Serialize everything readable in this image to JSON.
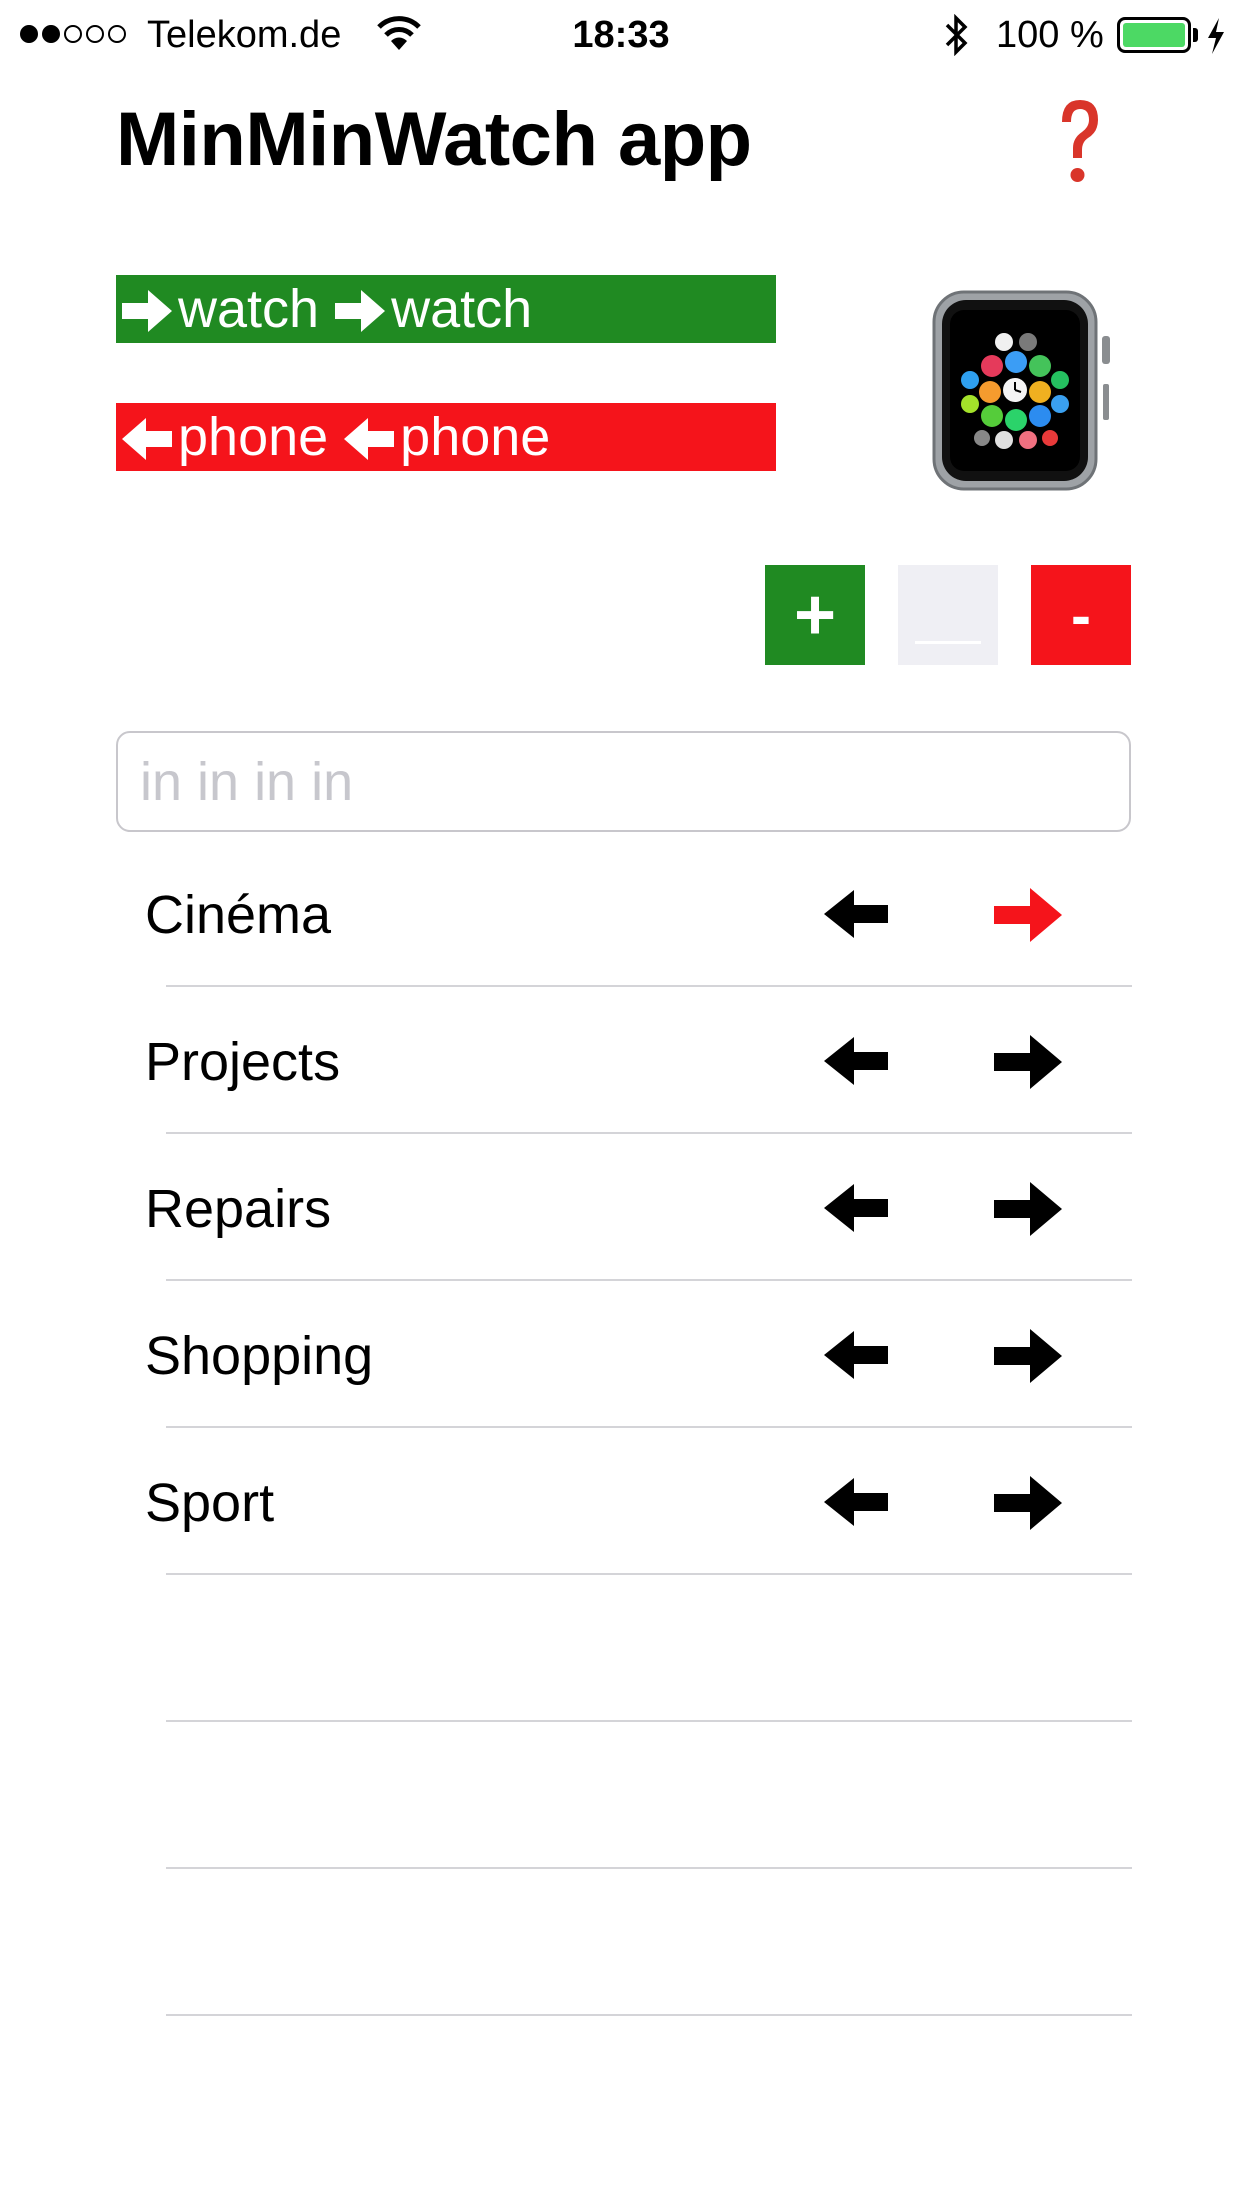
{
  "status_bar": {
    "signal_dots": [
      true,
      true,
      false,
      false,
      false
    ],
    "carrier": "Telekom.de",
    "time": "18:33",
    "battery_percent": "100 %",
    "battery_color": "#4cd964",
    "icons": [
      "wifi-icon",
      "bluetooth-icon",
      "battery-icon",
      "charging-icon"
    ]
  },
  "header": {
    "title": "MinMinWatch app",
    "help_icon": "question-mark-icon",
    "help_color": "#d9352a"
  },
  "banners": {
    "to_watch": {
      "word1": "watch",
      "word2": "watch",
      "color": "#208a22",
      "icon": "arrow-right-icon"
    },
    "to_phone": {
      "word1": "phone",
      "word2": "phone",
      "color": "#f5141b",
      "icon": "arrow-left-icon"
    }
  },
  "watch_image": "apple-watch-icon",
  "actions": {
    "add_label": "+",
    "add_color": "#208a22",
    "blank_color": "#efeff4",
    "remove_label": "-",
    "remove_color": "#f5141b"
  },
  "input": {
    "value": "",
    "placeholder": "in in in in"
  },
  "list": {
    "items": [
      {
        "label": "Cinéma",
        "right_arrow_color": "#f5141b"
      },
      {
        "label": "Projects",
        "right_arrow_color": "#000000"
      },
      {
        "label": "Repairs",
        "right_arrow_color": "#000000"
      },
      {
        "label": "Shopping",
        "right_arrow_color": "#000000"
      },
      {
        "label": "Sport",
        "right_arrow_color": "#000000"
      },
      {
        "label": ""
      },
      {
        "label": ""
      },
      {
        "label": ""
      }
    ]
  }
}
